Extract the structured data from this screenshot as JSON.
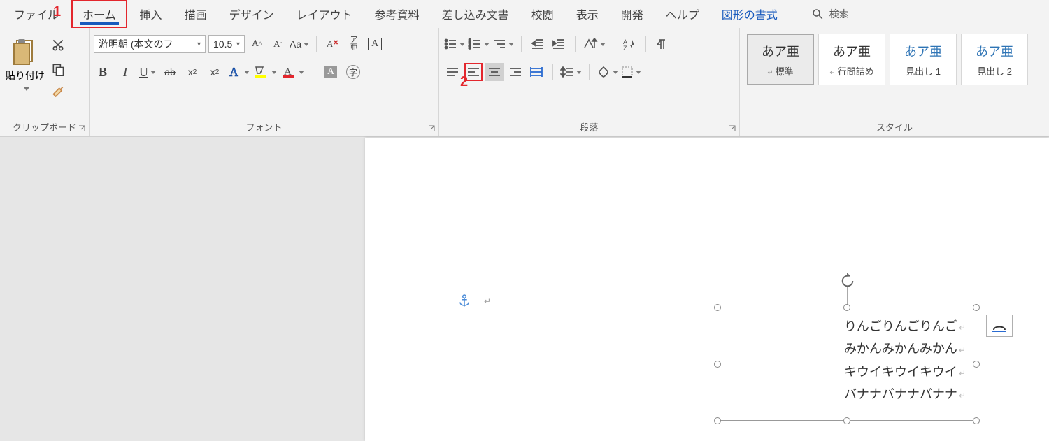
{
  "tabs": {
    "file": "ファイル",
    "home": "ホーム",
    "insert": "挿入",
    "draw": "描画",
    "design": "デザイン",
    "layout": "レイアウト",
    "references": "参考資料",
    "mailings": "差し込み文書",
    "review": "校閲",
    "view": "表示",
    "developer": "開発",
    "help": "ヘルプ",
    "shape_format": "図形の書式"
  },
  "search": {
    "label": "検索"
  },
  "clipboard": {
    "paste": "貼り付け",
    "group_label": "クリップボード"
  },
  "font": {
    "name": "游明朝 (本文のフ",
    "size": "10.5",
    "group_label": "フォント",
    "aa_label": "Aa"
  },
  "paragraph": {
    "group_label": "段落"
  },
  "styles": {
    "group_label": "スタイル",
    "sample": "あア亜",
    "items": [
      {
        "label": "標準"
      },
      {
        "label": "行間詰め"
      },
      {
        "label": "見出し 1"
      },
      {
        "label": "見出し 2"
      }
    ]
  },
  "callouts": {
    "one": "1",
    "two": "2"
  },
  "textbox": {
    "lines": [
      "りんごりんごりんご",
      "みかんみかんみかん",
      "キウイキウイキウイ",
      "バナナバナナバナナ"
    ]
  }
}
